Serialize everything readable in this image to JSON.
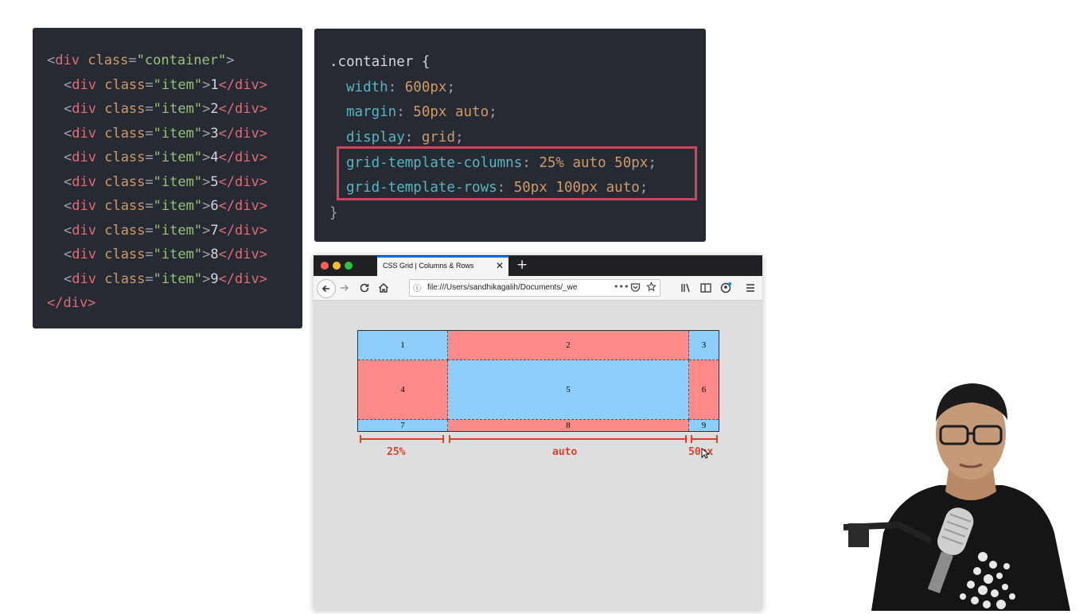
{
  "html_code": {
    "lines": [
      {
        "open": "<",
        "tag": "div",
        "attr": "class",
        "eq": "=",
        "str": "\"container\"",
        "close": ">",
        "text": "",
        "end": ""
      },
      {
        "open": "<",
        "tag": "div",
        "attr": "class",
        "eq": "=",
        "str": "\"item\"",
        "close": ">",
        "text": "1",
        "end": "</div>"
      },
      {
        "open": "<",
        "tag": "div",
        "attr": "class",
        "eq": "=",
        "str": "\"item\"",
        "close": ">",
        "text": "2",
        "end": "</div>"
      },
      {
        "open": "<",
        "tag": "div",
        "attr": "class",
        "eq": "=",
        "str": "\"item\"",
        "close": ">",
        "text": "3",
        "end": "</div>"
      },
      {
        "open": "<",
        "tag": "div",
        "attr": "class",
        "eq": "=",
        "str": "\"item\"",
        "close": ">",
        "text": "4",
        "end": "</div>"
      },
      {
        "open": "<",
        "tag": "div",
        "attr": "class",
        "eq": "=",
        "str": "\"item\"",
        "close": ">",
        "text": "5",
        "end": "</div>"
      },
      {
        "open": "<",
        "tag": "div",
        "attr": "class",
        "eq": "=",
        "str": "\"item\"",
        "close": ">",
        "text": "6",
        "end": "</div>"
      },
      {
        "open": "<",
        "tag": "div",
        "attr": "class",
        "eq": "=",
        "str": "\"item\"",
        "close": ">",
        "text": "7",
        "end": "</div>"
      },
      {
        "open": "<",
        "tag": "div",
        "attr": "class",
        "eq": "=",
        "str": "\"item\"",
        "close": ">",
        "text": "8",
        "end": "</div>"
      },
      {
        "open": "<",
        "tag": "div",
        "attr": "class",
        "eq": "=",
        "str": "\"item\"",
        "close": ">",
        "text": "9",
        "end": "</div>"
      }
    ],
    "closing": "</div>"
  },
  "css_code": {
    "selector": ".container {",
    "declarations": [
      {
        "prop": "width",
        "value": "600px"
      },
      {
        "prop": "margin",
        "value": "50px auto"
      },
      {
        "prop": "display",
        "value": "grid"
      },
      {
        "prop": "grid-template-columns",
        "value": "25% auto 50px"
      },
      {
        "prop": "grid-template-rows",
        "value": "50px 100px auto"
      }
    ],
    "closing": "}"
  },
  "browser": {
    "tab_title": "CSS Grid | Columns & Rows",
    "tab_close": "✕",
    "new_tab": "+",
    "url": "file:///Users/sandhikagalih/Documents/_we",
    "url_info_icon": "ⓘ",
    "url_more": "•••",
    "icons": [
      "back-arrow-icon",
      "forward-arrow-icon",
      "reload-icon",
      "home-icon",
      "info-icon",
      "pocket-icon",
      "star-icon",
      "library-icon",
      "sidebar-icon",
      "account-icon",
      "menu-icon"
    ]
  },
  "grid_demo": {
    "items": [
      {
        "label": "1",
        "color": "blue"
      },
      {
        "label": "2",
        "color": "pink"
      },
      {
        "label": "3",
        "color": "blue"
      },
      {
        "label": "4",
        "color": "pink"
      },
      {
        "label": "5",
        "color": "blue"
      },
      {
        "label": "6",
        "color": "pink"
      },
      {
        "label": "7",
        "color": "blue"
      },
      {
        "label": "8",
        "color": "pink"
      },
      {
        "label": "9",
        "color": "blue"
      }
    ],
    "measure_labels": [
      "25%",
      "auto",
      "50px"
    ]
  },
  "colors": {
    "code_bg": "#262a33",
    "highlight": "#d7415a",
    "cell_blue": "#8dcefc",
    "cell_pink": "#fe8a8a",
    "measure": "#e0412a"
  }
}
